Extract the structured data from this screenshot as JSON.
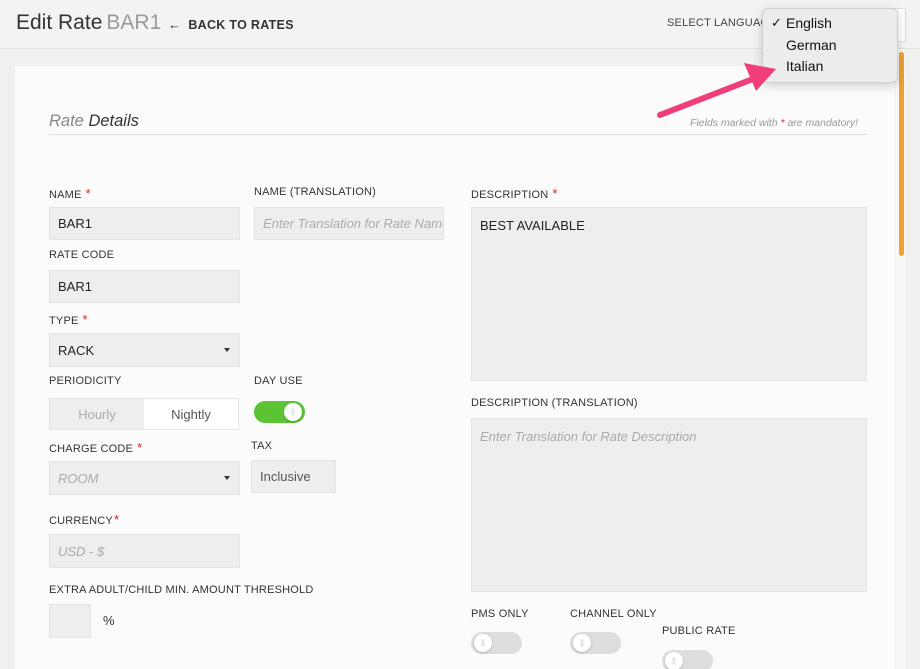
{
  "header": {
    "title": "Edit Rate",
    "rate_code": "BAR1",
    "back_label": "BACK TO RATES",
    "language_label": "SELECT LANGUAGE"
  },
  "language_menu": {
    "options": [
      "English",
      "German",
      "Italian"
    ],
    "selected": "English",
    "check_mark": "✓"
  },
  "section": {
    "title_light": "Rate",
    "title_main": "Details",
    "mandatory_note_pre": "Fields marked with",
    "mandatory_note_star": "*",
    "mandatory_note_post": "are mandatory!"
  },
  "form": {
    "name": {
      "label": "NAME",
      "value": "BAR1"
    },
    "name_translation": {
      "label": "NAME (TRANSLATION)",
      "placeholder": "Enter Translation for Rate Name"
    },
    "rate_code": {
      "label": "RATE CODE",
      "value": "BAR1"
    },
    "type": {
      "label": "TYPE",
      "value": "RACK"
    },
    "periodicity": {
      "label": "PERIODICITY",
      "options": [
        "Hourly",
        "Nightly"
      ],
      "selected": "Nightly"
    },
    "day_use": {
      "label": "DAY USE",
      "on": true
    },
    "charge_code": {
      "label": "CHARGE CODE",
      "placeholder": "ROOM"
    },
    "tax": {
      "label": "TAX",
      "value": "Inclusive"
    },
    "currency": {
      "label": "CURRENCY",
      "placeholder": "USD - $"
    },
    "threshold": {
      "label": "EXTRA ADULT/CHILD MIN. AMOUNT THRESHOLD",
      "unit": "%"
    },
    "description": {
      "label": "DESCRIPTION",
      "value": "BEST AVAILABLE"
    },
    "description_translation": {
      "label": "DESCRIPTION (TRANSLATION)",
      "placeholder": "Enter Translation for Rate Description"
    },
    "pms_only": {
      "label": "PMS ONLY",
      "on": false
    },
    "channel_only": {
      "label": "CHANNEL ONLY",
      "on": false
    },
    "public_rate": {
      "label": "PUBLIC RATE"
    }
  },
  "colors": {
    "accent_toggle_on": "#5cc334",
    "required_star": "#dd2222",
    "scrollbar": "#f0a132",
    "annotation_arrow": "#f03e7a"
  }
}
